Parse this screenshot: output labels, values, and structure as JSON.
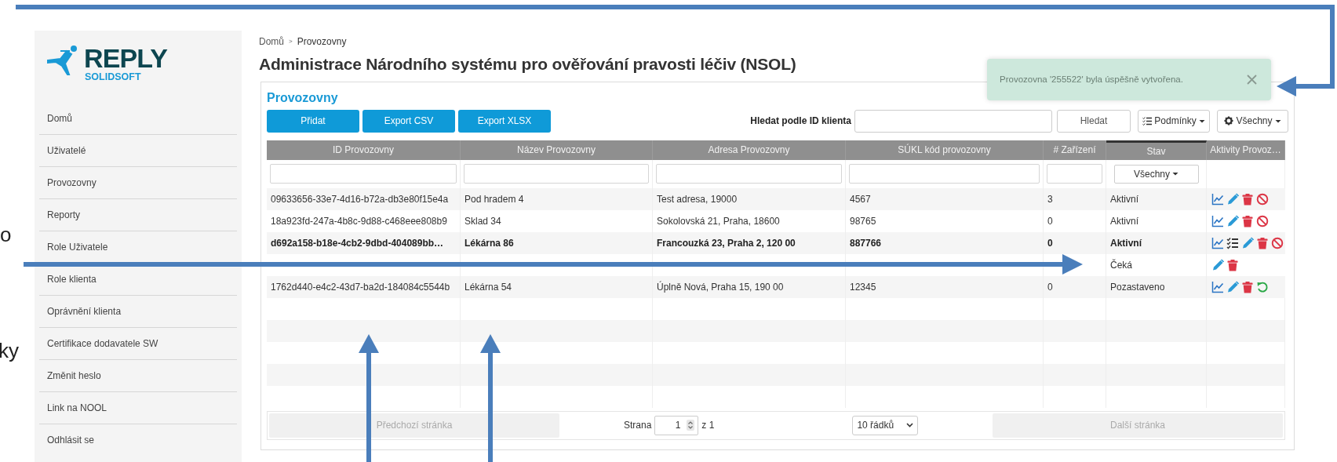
{
  "slide_fragments": [
    "o",
    "ky"
  ],
  "logo": {
    "name": "REPLY",
    "sub": "SOLIDSOFT"
  },
  "sidebar": {
    "items": [
      "Domů",
      "Uživatelé",
      "Provozovny",
      "Reporty",
      "Role Uživatele",
      "Role klienta",
      "Oprávnění klienta",
      "Certifikace dodavatele SW",
      "Změnit heslo",
      "Link na NOOL",
      "Odhlásit se"
    ]
  },
  "breadcrumb": {
    "items": [
      "Domů",
      "Provozovny"
    ],
    "separator": ">"
  },
  "title": "Administrace Národního systému pro ověřování pravosti léčiv (NSOL)",
  "toast": {
    "text": "Provozovna '255522' byla úspěšně vytvořena."
  },
  "panel": {
    "title": "Provozovny",
    "buttons": [
      "Přidat",
      "Export CSV",
      "Export XLSX"
    ],
    "search_label": "Hledat podle ID klienta",
    "search_button": "Hledat",
    "conditions_button": "Podmínky",
    "view_button": "Všechny"
  },
  "table": {
    "columns": [
      {
        "label": "ID Provozovny",
        "kind": "text",
        "sorted": false
      },
      {
        "label": "Název Provozovny",
        "kind": "text",
        "sorted": false
      },
      {
        "label": "Adresa Provozovny",
        "kind": "text",
        "sorted": false
      },
      {
        "label": "SÚKL kód provozovny",
        "kind": "text",
        "sorted": false
      },
      {
        "label": "# Zařízení",
        "kind": "text",
        "sorted": false
      },
      {
        "label": "Stav",
        "kind": "select",
        "sorted": true
      },
      {
        "label": "Aktivity Provoz…",
        "kind": "none",
        "sorted": false
      }
    ],
    "status_filter": "Všechny",
    "rows": [
      {
        "id": "09633656-33e7-4d16-b72a-db3e80f15e4a",
        "name": "Pod hradem 4",
        "address": "Test adresa, 19000",
        "sukl": "4567",
        "devices": "3",
        "status": "Aktivní",
        "bold": false,
        "actions": [
          {
            "kind": "chart"
          },
          {
            "kind": "pencil"
          },
          {
            "kind": "trash"
          },
          {
            "kind": "ban"
          }
        ]
      },
      {
        "id": "18a923fd-247a-4b8c-9d88-c468eee808b9",
        "name": "Sklad 34",
        "address": "Sokolovská 21, Praha, 18600",
        "sukl": "98765",
        "devices": "0",
        "status": "Aktivní",
        "bold": false,
        "actions": [
          {
            "kind": "chart"
          },
          {
            "kind": "pencil"
          },
          {
            "kind": "trash"
          },
          {
            "kind": "ban"
          }
        ]
      },
      {
        "id": "d692a158-b18e-4cb2-9dbd-404089bb…",
        "name": "Lékárna 86",
        "address": "Francouzká 23, Praha 2, 120 00",
        "sukl": "887766",
        "devices": "0",
        "status": "Aktivní",
        "bold": true,
        "actions": [
          {
            "kind": "chart"
          },
          {
            "kind": "checklist"
          },
          {
            "kind": "pencil"
          },
          {
            "kind": "trash"
          },
          {
            "kind": "ban"
          }
        ]
      },
      {
        "status": "Čeká",
        "bold": false,
        "actions": [
          {
            "kind": "pencil"
          },
          {
            "kind": "trash"
          }
        ]
      },
      {
        "id": "1762d440-e4c2-43d7-ba2d-184084c5544b",
        "name": "Lékárna 54",
        "address": "Úplně Nová, Praha 15, 190 00",
        "sukl": "12345",
        "devices": "0",
        "status": "Pozastaveno",
        "bold": false,
        "actions": [
          {
            "kind": "chart"
          },
          {
            "kind": "pencil"
          },
          {
            "kind": "trash"
          },
          {
            "kind": "undo"
          }
        ]
      }
    ]
  },
  "pagination": {
    "previous": {
      "label": "Předchozí stránka",
      "disabled": true
    },
    "page_label": "Strana",
    "page": "1",
    "of": "z 1",
    "rows_per_page": "10 řádků",
    "next": {
      "label": "Další stránka",
      "disabled": true
    }
  }
}
